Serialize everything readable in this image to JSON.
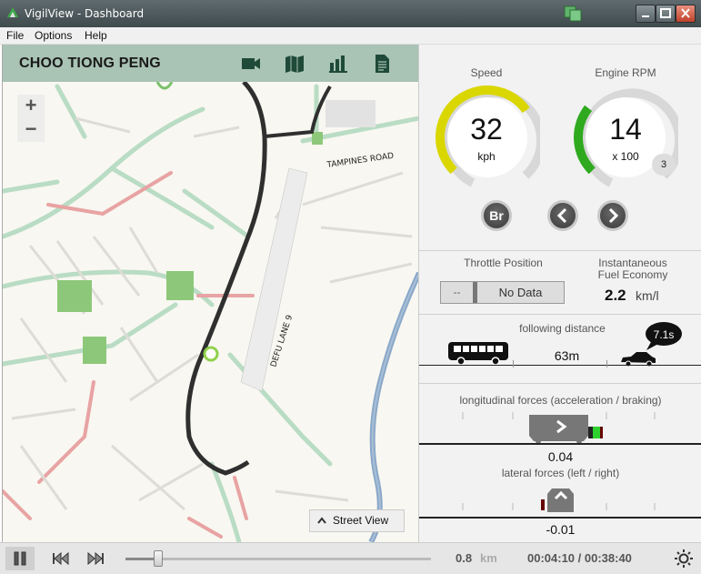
{
  "window": {
    "title": "VigilView - Dashboard",
    "controls": [
      "minimize",
      "maximize",
      "close"
    ]
  },
  "menu": {
    "items": [
      "File",
      "Options",
      "Help"
    ]
  },
  "map": {
    "driver_name": "CHOO TIONG PENG",
    "header_icons": [
      "video-camera-icon",
      "map-icon",
      "bar-chart-icon",
      "document-icon"
    ],
    "zoom_in": "+",
    "zoom_out": "−",
    "road_labels": [
      "TAMPINES ROAD",
      "DEFU LANE 9"
    ],
    "street_view_label": "Street View"
  },
  "dashboard": {
    "speed": {
      "label": "Speed",
      "value": "32",
      "unit": "kph",
      "fraction": 0.32,
      "color": "#d9d600"
    },
    "rpm": {
      "label": "Engine RPM",
      "value": "14",
      "unit": "x 100",
      "fraction": 0.14,
      "color": "#2faa1f",
      "gear": "3"
    },
    "buttons": {
      "brake": "Br",
      "left": "left-arrow-icon",
      "right": "right-arrow-icon"
    },
    "throttle": {
      "label": "Throttle Position",
      "left_text": "--",
      "value": "No Data"
    },
    "fuel": {
      "label_line1": "Instantaneous",
      "label_line2": "Fuel Economy",
      "value": "2.2",
      "unit": "km/l"
    },
    "following": {
      "label": "following distance",
      "distance": "63m",
      "time": "7.1s"
    },
    "longitudinal": {
      "label": "longitudinal forces (acceleration / braking)",
      "value": "0.04"
    },
    "lateral": {
      "label": "lateral forces (left / right)",
      "value": "-0.01"
    }
  },
  "playback": {
    "distance_value": "0.8",
    "distance_unit": "km",
    "time": "00:04:10 / 00:38:40",
    "progress_fraction": 0.108
  }
}
